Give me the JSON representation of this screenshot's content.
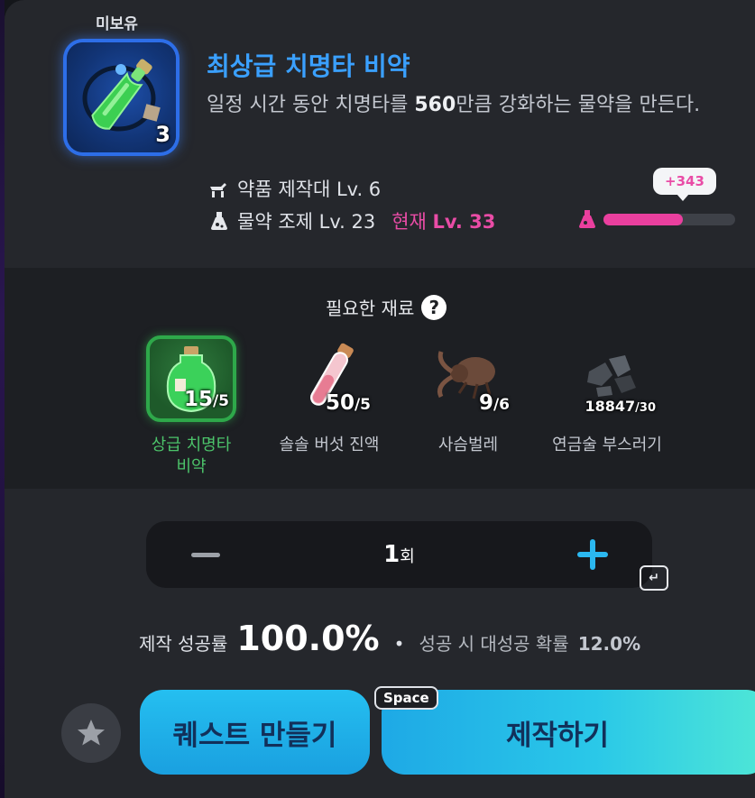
{
  "item": {
    "owned_status": "미보유",
    "title": "최상급 치명타 비약",
    "description_prefix": "일정 시간 동안 치명타를 ",
    "description_value": "560",
    "description_suffix": "만큼 강화하는 물약을 만든다.",
    "count": "3"
  },
  "requirements": {
    "station_label": "약품 제작대 Lv. 6",
    "skill_label": "물약 조제 Lv. 23",
    "current_prefix": "현재",
    "current_level": "Lv. 33"
  },
  "progress": {
    "gain_text": "+343",
    "fraction": 0.6,
    "color": "#ea3f9e"
  },
  "materials": {
    "title": "필요한 재료",
    "items": [
      {
        "name_line1": "상급 치명타",
        "name_line2": "비약",
        "have": "15",
        "need": "/5",
        "owned": true
      },
      {
        "name_line1": "솔솔 버섯 진액",
        "have": "50",
        "need": "/5"
      },
      {
        "name_line1": "사슴벌레",
        "have": "9",
        "need": "/6"
      },
      {
        "name_line1": "연금술 부스러기",
        "have": "18847",
        "need": "/30"
      }
    ]
  },
  "quantity": {
    "value": "1",
    "unit": "회",
    "enter_key": "↵"
  },
  "rates": {
    "success_label": "제작 성공률",
    "success_value": "100.0%",
    "separator": "•",
    "great_label": "성공 시 대성공 확률",
    "great_value": "12.0%"
  },
  "buttons": {
    "quest_label": "퀘스트 만들기",
    "craft_label": "제작하기",
    "space_key": "Space"
  },
  "colors": {
    "accent_blue": "#3aa0ff",
    "level_pink": "#e94ca6",
    "owned_green": "#4cc36a"
  }
}
